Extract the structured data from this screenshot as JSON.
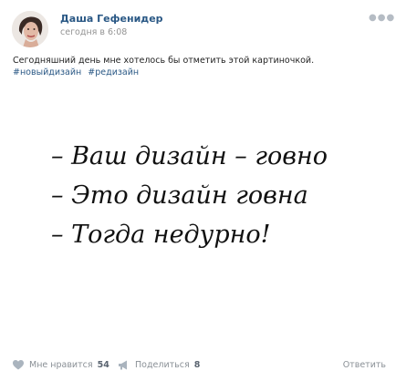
{
  "post": {
    "author": "Даша Гефенидер",
    "time": "сегодня в 6:08",
    "more_icon": "ellipsis-icon",
    "text": "Сегодняшний день мне хотелось бы отметить этой картиночкой.",
    "tags": [
      "#новыйдизайн",
      "#редизайн"
    ]
  },
  "image": {
    "lines": [
      "– Ваш дизайн – говно",
      "– Это дизайн говна",
      "– Тогда недурно!"
    ]
  },
  "footer": {
    "like_label": "Мне нравится",
    "like_count": "54",
    "share_label": "Поделиться",
    "share_count": "8",
    "reply_label": "Ответить"
  }
}
